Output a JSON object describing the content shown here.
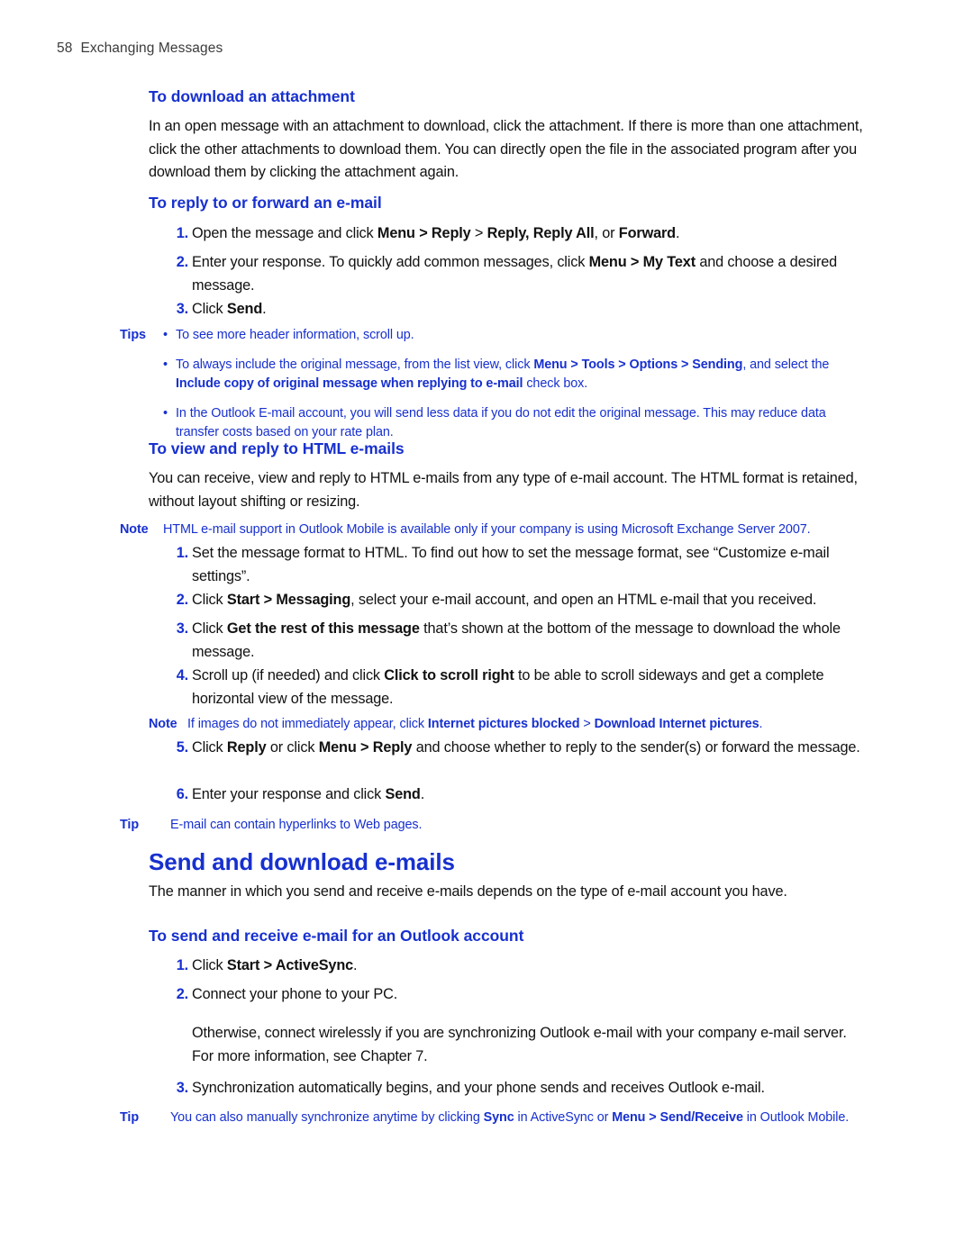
{
  "page": {
    "number": "58",
    "running_title": "Exchanging Messages",
    "accent_color": "#1730cf",
    "text_color": "#111111"
  },
  "sections": {
    "download_attachment": {
      "heading": "To download an attachment",
      "paragraph": "In an open message with an attachment to download, click the attachment.  If there is more than one attachment, click the other attachments to download them. You can directly open the file in the associated program after you download them by clicking the attachment again."
    },
    "reply_forward": {
      "heading": "To reply to or forward an e-mail",
      "steps": [
        {
          "num": "1.",
          "html": "Open the message and click <b>Menu &gt; Reply</b> &gt;  <b>Reply, Reply All</b>, or <b>Forward</b>."
        },
        {
          "num": "2.",
          "html": "Enter your response. To quickly add common messages, click <b>Menu &gt; My Text</b> and choose a desired message."
        },
        {
          "num": "3.",
          "html": "Click <b>Send</b>."
        }
      ],
      "tips": {
        "label": "Tips",
        "bullet": "•",
        "items": [
          "To see more header information, scroll up.",
          "To always include the original message, from the list view, click <b>Menu &gt; Tools &gt; Options &gt; Sending</b>, and select the <b>Include copy of original message when replying to e-mail</b> check box.",
          "In the Outlook E-mail account, you will send less data if you do not edit the original message. This may reduce data transfer costs based on your rate plan."
        ]
      }
    },
    "html_emails": {
      "heading": "To view and reply to HTML e-mails",
      "paragraph": "You can receive, view and reply to HTML e-mails from any type of e-mail account. The HTML format is retained, without layout shifting or resizing.",
      "note_top": {
        "label": "Note",
        "html": "HTML e-mail support in Outlook Mobile is available only if your company is using Microsoft Exchange Server 2007."
      },
      "steps": [
        {
          "num": "1.",
          "html": "Set the message format to HTML. To find out how to set the message format, see “Customize e-mail settings”."
        },
        {
          "num": "2.",
          "html": "Click <b>Start &gt; Messaging</b>, select your e-mail account, and open an HTML e-mail that you received."
        },
        {
          "num": "3.",
          "html": "Click <b>Get the rest of this message</b> that’s shown at the bottom of the message to download the whole message."
        },
        {
          "num": "4.",
          "html": "Scroll up (if needed) and click <b>Click to scroll right</b> to be able to scroll sideways and get a complete horizontal view of the message."
        }
      ],
      "note_images": {
        "label": "Note",
        "html": "If images do not immediately appear, click <b>Internet pictures blocked</b> &gt; <b>Download Internet pictures</b>."
      },
      "steps_cont": [
        {
          "num": "5.",
          "html": "Click <b>Reply</b> or click <b>Menu &gt; Reply</b> and choose whether to reply to the sender(s) or forward the message."
        },
        {
          "num": "6.",
          "html": "Enter your response and click <b>Send</b>."
        }
      ],
      "tip": {
        "label": "Tip",
        "html": "E-mail can contain hyperlinks to Web pages."
      }
    },
    "send_download": {
      "heading": "Send and download e-mails",
      "paragraph": "The manner in which you send and receive e-mails depends on the type of e-mail account you have.",
      "outlook_account": {
        "heading": "To send and receive e-mail for an Outlook account",
        "steps": [
          {
            "num": "1.",
            "html": "Click <b>Start &gt; ActiveSync</b>."
          },
          {
            "num": "2.",
            "html": "Connect your phone to your PC."
          }
        ],
        "continuation": "Otherwise, connect wirelessly if you are synchronizing Outlook e-mail with your company e-mail server. For more information, see Chapter 7.",
        "steps_cont": [
          {
            "num": "3.",
            "html": "Synchronization automatically begins, and your phone sends and receives Outlook e-mail."
          }
        ],
        "tip": {
          "label": "Tip",
          "html": "You can also manually synchronize anytime by clicking <b>Sync</b> in ActiveSync or <b>Menu &gt; Send/Receive</b> in Outlook Mobile."
        }
      }
    }
  }
}
